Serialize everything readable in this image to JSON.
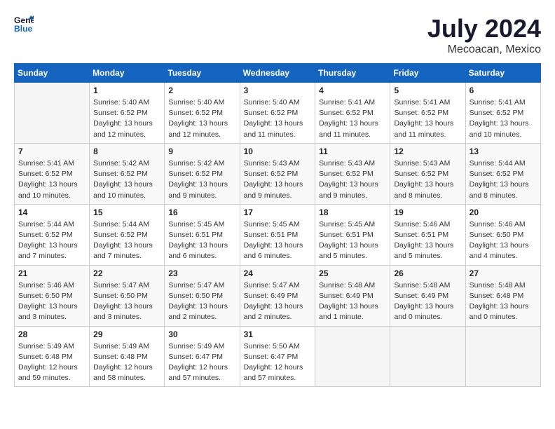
{
  "header": {
    "logo_line1": "General",
    "logo_line2": "Blue",
    "month_year": "July 2024",
    "location": "Mecoacan, Mexico"
  },
  "columns": [
    "Sunday",
    "Monday",
    "Tuesday",
    "Wednesday",
    "Thursday",
    "Friday",
    "Saturday"
  ],
  "weeks": [
    [
      {
        "day": "",
        "info": ""
      },
      {
        "day": "1",
        "info": "Sunrise: 5:40 AM\nSunset: 6:52 PM\nDaylight: 13 hours\nand 12 minutes."
      },
      {
        "day": "2",
        "info": "Sunrise: 5:40 AM\nSunset: 6:52 PM\nDaylight: 13 hours\nand 12 minutes."
      },
      {
        "day": "3",
        "info": "Sunrise: 5:40 AM\nSunset: 6:52 PM\nDaylight: 13 hours\nand 11 minutes."
      },
      {
        "day": "4",
        "info": "Sunrise: 5:41 AM\nSunset: 6:52 PM\nDaylight: 13 hours\nand 11 minutes."
      },
      {
        "day": "5",
        "info": "Sunrise: 5:41 AM\nSunset: 6:52 PM\nDaylight: 13 hours\nand 11 minutes."
      },
      {
        "day": "6",
        "info": "Sunrise: 5:41 AM\nSunset: 6:52 PM\nDaylight: 13 hours\nand 10 minutes."
      }
    ],
    [
      {
        "day": "7",
        "info": "Sunrise: 5:41 AM\nSunset: 6:52 PM\nDaylight: 13 hours\nand 10 minutes."
      },
      {
        "day": "8",
        "info": "Sunrise: 5:42 AM\nSunset: 6:52 PM\nDaylight: 13 hours\nand 10 minutes."
      },
      {
        "day": "9",
        "info": "Sunrise: 5:42 AM\nSunset: 6:52 PM\nDaylight: 13 hours\nand 9 minutes."
      },
      {
        "day": "10",
        "info": "Sunrise: 5:43 AM\nSunset: 6:52 PM\nDaylight: 13 hours\nand 9 minutes."
      },
      {
        "day": "11",
        "info": "Sunrise: 5:43 AM\nSunset: 6:52 PM\nDaylight: 13 hours\nand 9 minutes."
      },
      {
        "day": "12",
        "info": "Sunrise: 5:43 AM\nSunset: 6:52 PM\nDaylight: 13 hours\nand 8 minutes."
      },
      {
        "day": "13",
        "info": "Sunrise: 5:44 AM\nSunset: 6:52 PM\nDaylight: 13 hours\nand 8 minutes."
      }
    ],
    [
      {
        "day": "14",
        "info": "Sunrise: 5:44 AM\nSunset: 6:52 PM\nDaylight: 13 hours\nand 7 minutes."
      },
      {
        "day": "15",
        "info": "Sunrise: 5:44 AM\nSunset: 6:52 PM\nDaylight: 13 hours\nand 7 minutes."
      },
      {
        "day": "16",
        "info": "Sunrise: 5:45 AM\nSunset: 6:51 PM\nDaylight: 13 hours\nand 6 minutes."
      },
      {
        "day": "17",
        "info": "Sunrise: 5:45 AM\nSunset: 6:51 PM\nDaylight: 13 hours\nand 6 minutes."
      },
      {
        "day": "18",
        "info": "Sunrise: 5:45 AM\nSunset: 6:51 PM\nDaylight: 13 hours\nand 5 minutes."
      },
      {
        "day": "19",
        "info": "Sunrise: 5:46 AM\nSunset: 6:51 PM\nDaylight: 13 hours\nand 5 minutes."
      },
      {
        "day": "20",
        "info": "Sunrise: 5:46 AM\nSunset: 6:50 PM\nDaylight: 13 hours\nand 4 minutes."
      }
    ],
    [
      {
        "day": "21",
        "info": "Sunrise: 5:46 AM\nSunset: 6:50 PM\nDaylight: 13 hours\nand 3 minutes."
      },
      {
        "day": "22",
        "info": "Sunrise: 5:47 AM\nSunset: 6:50 PM\nDaylight: 13 hours\nand 3 minutes."
      },
      {
        "day": "23",
        "info": "Sunrise: 5:47 AM\nSunset: 6:50 PM\nDaylight: 13 hours\nand 2 minutes."
      },
      {
        "day": "24",
        "info": "Sunrise: 5:47 AM\nSunset: 6:49 PM\nDaylight: 13 hours\nand 2 minutes."
      },
      {
        "day": "25",
        "info": "Sunrise: 5:48 AM\nSunset: 6:49 PM\nDaylight: 13 hours\nand 1 minute."
      },
      {
        "day": "26",
        "info": "Sunrise: 5:48 AM\nSunset: 6:49 PM\nDaylight: 13 hours\nand 0 minutes."
      },
      {
        "day": "27",
        "info": "Sunrise: 5:48 AM\nSunset: 6:48 PM\nDaylight: 13 hours\nand 0 minutes."
      }
    ],
    [
      {
        "day": "28",
        "info": "Sunrise: 5:49 AM\nSunset: 6:48 PM\nDaylight: 12 hours\nand 59 minutes."
      },
      {
        "day": "29",
        "info": "Sunrise: 5:49 AM\nSunset: 6:48 PM\nDaylight: 12 hours\nand 58 minutes."
      },
      {
        "day": "30",
        "info": "Sunrise: 5:49 AM\nSunset: 6:47 PM\nDaylight: 12 hours\nand 57 minutes."
      },
      {
        "day": "31",
        "info": "Sunrise: 5:50 AM\nSunset: 6:47 PM\nDaylight: 12 hours\nand 57 minutes."
      },
      {
        "day": "",
        "info": ""
      },
      {
        "day": "",
        "info": ""
      },
      {
        "day": "",
        "info": ""
      }
    ]
  ]
}
